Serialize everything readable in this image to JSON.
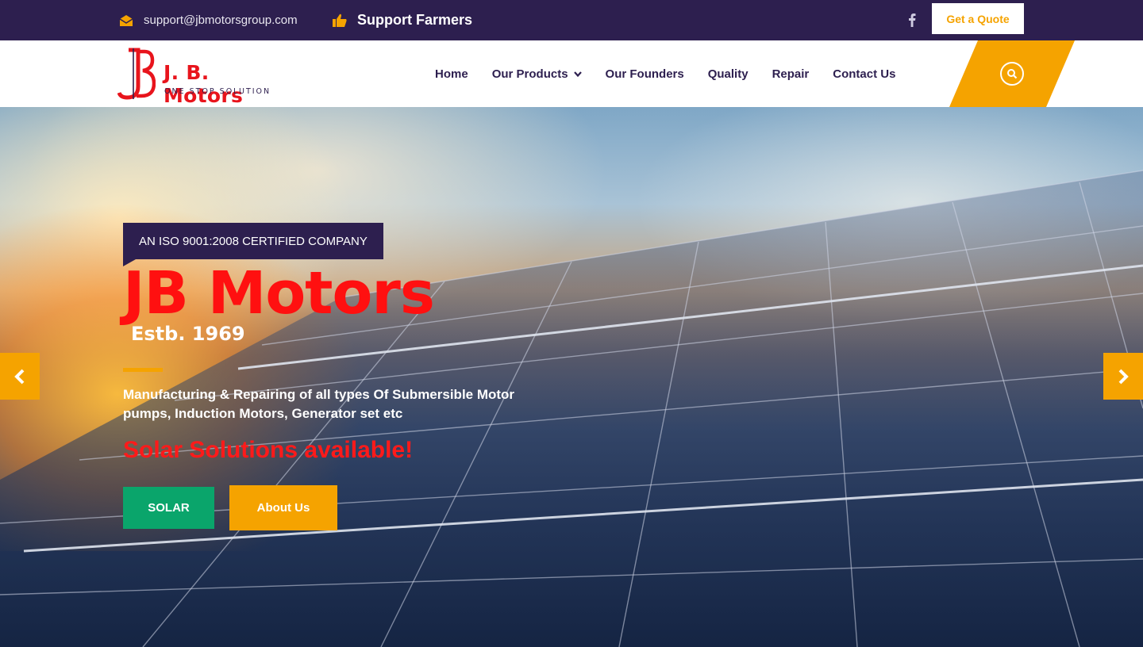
{
  "colors": {
    "topbar_bg": "#2d1f4f",
    "accent_orange": "#f5a300",
    "brand_red": "#e8141c",
    "solar_green": "#0aa56b",
    "nav_text": "#2d1f4f"
  },
  "topbar": {
    "email": "support@jbmotorsgroup.com",
    "email_icon": "envelope-open-icon",
    "support_label": "Support Farmers",
    "support_icon": "thumbs-up-icon",
    "facebook_icon": "facebook-icon",
    "quote_button": "Get a Quote"
  },
  "header": {
    "logo": {
      "name": "J. B. Motors",
      "tagline": "ONE STOP SOLUTION",
      "mark_icon": "jb-monogram-logo"
    },
    "nav": [
      {
        "label": "Home"
      },
      {
        "label": "Our Products",
        "has_dropdown": true
      },
      {
        "label": "Our Founders"
      },
      {
        "label": "Quality"
      },
      {
        "label": "Repair"
      },
      {
        "label": "Contact Us"
      }
    ],
    "search_icon": "search-icon"
  },
  "hero": {
    "badge": "AN ISO 9001:2008 CERTIFIED COMPANY",
    "title": "JB Motors",
    "subtitle": "Estb. 1969",
    "description": "Manufacturing & Repairing of all types Of Submersible Motor pumps, Induction Motors, Generator set etc",
    "highlight": "Solar Solutions available!",
    "buttons": {
      "solar": "SOLAR",
      "about": "About Us"
    },
    "prev_icon": "chevron-left-icon",
    "next_icon": "chevron-right-icon"
  }
}
